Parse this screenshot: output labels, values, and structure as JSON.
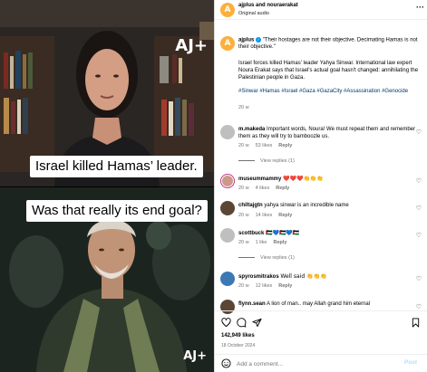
{
  "media": {
    "caption_top": "Israel killed Hamas’ leader.",
    "caption_bottom": "Was that really its end goal?",
    "brand_mark": "AJ+"
  },
  "header": {
    "username": "ajplus and nouraerakat",
    "subtitle": "Original audio"
  },
  "caption": {
    "username": "ajplus",
    "quote": "\"Their hostages are not their objective. Decimating Hamas is not their objective.\"",
    "body": "Israel forces killed Hamas' leader Yahya Sinwar. International law expert Noura Erakat says that Israel's actual goal hasn't changed: annihilating the Palestinian people in Gaza.",
    "hashtags": "#Sinwar #Hamas #Israel #Gaza #GazaCity #Assassination #Genocide",
    "time": "20 w"
  },
  "comments": [
    {
      "user": "m.makeda",
      "text": "Important words, Noura! We must repeat them and remember them as they will try to bamboozle us.",
      "time": "20 w",
      "likes": "53 likes",
      "reply": "Reply",
      "view_replies": "View replies (1)"
    },
    {
      "user": "museummammy",
      "text": "❤️❤️❤️👏👏👏",
      "time": "20 w",
      "likes": "4 likes",
      "reply": "Reply"
    },
    {
      "user": "chiltajgtn",
      "text": "yahya sinwar is an incredible name",
      "time": "20 w",
      "likes": "14 likes",
      "reply": "Reply"
    },
    {
      "user": "scottbuck",
      "text": "🇵🇸💙🇵🇸💙🇵🇸",
      "time": "20 w",
      "likes": "1 like",
      "reply": "Reply",
      "view_replies": "View replies (1)"
    },
    {
      "user": "spyrosmitrakos",
      "text": "Well said 👏👏👏",
      "time": "20 w",
      "likes": "12 likes",
      "reply": "Reply"
    },
    {
      "user": "flynn.sean",
      "text": "A lion of man.. may Allah grand him eternal",
      "time": "",
      "likes": "",
      "reply": ""
    }
  ],
  "actions": {
    "likes": "142,949 likes",
    "date": "18 October 2024"
  },
  "add_comment": {
    "placeholder": "Add a comment...",
    "post_label": "Post"
  },
  "colors": {
    "link": "#00376b",
    "verified": "#0095f6",
    "brand": "#fbb03b"
  }
}
